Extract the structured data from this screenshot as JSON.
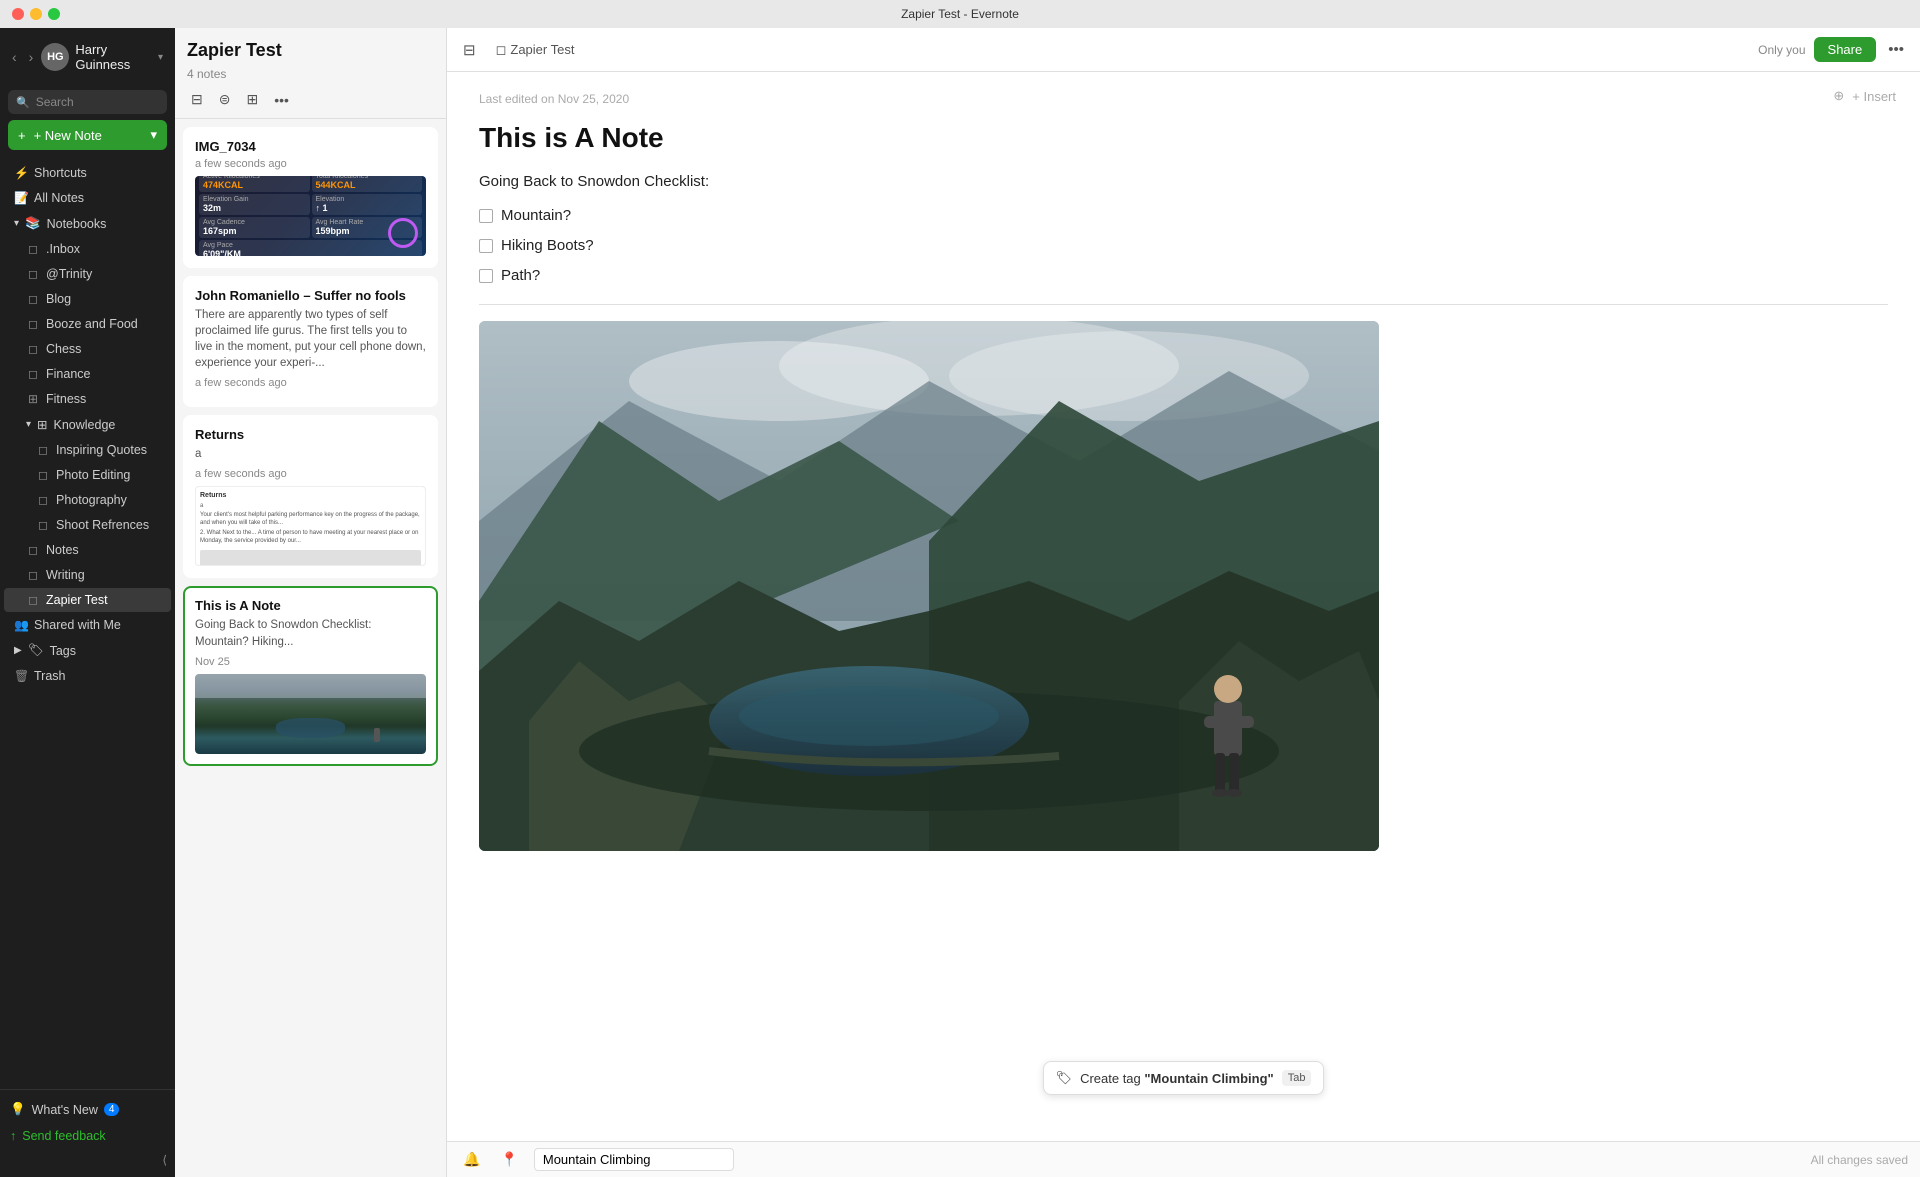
{
  "app": {
    "title": "Zapier Test - Evernote"
  },
  "titlebar": {
    "title": "Zapier Test - Evernote"
  },
  "sidebar": {
    "user": {
      "name": "Harry Guinness",
      "initials": "HG"
    },
    "search_placeholder": "Search",
    "new_note_label": "+ New Note",
    "nav_items": [
      {
        "id": "shortcuts",
        "label": "Shortcuts",
        "icon": "⚡"
      },
      {
        "id": "all-notes",
        "label": "All Notes",
        "icon": "📝"
      }
    ],
    "notebooks_header": "Notebooks",
    "notebooks": [
      {
        "id": "inbox",
        "label": ".Inbox",
        "indent": 1
      },
      {
        "id": "trinity",
        "label": "@Trinity",
        "indent": 1
      },
      {
        "id": "blog",
        "label": "Blog",
        "indent": 1
      },
      {
        "id": "booze-food",
        "label": "Booze and Food",
        "indent": 1
      },
      {
        "id": "chess",
        "label": "Chess",
        "indent": 1
      },
      {
        "id": "finance",
        "label": "Finance",
        "indent": 1
      },
      {
        "id": "fitness",
        "label": "Fitness",
        "indent": 1
      },
      {
        "id": "knowledge",
        "label": "Knowledge",
        "indent": 1,
        "expanded": true
      },
      {
        "id": "inspiring-quotes",
        "label": "Inspiring Quotes",
        "indent": 2
      },
      {
        "id": "photo-editing",
        "label": "Photo Editing",
        "indent": 2
      },
      {
        "id": "photography",
        "label": "Photography",
        "indent": 2
      },
      {
        "id": "shoot-refs",
        "label": "Shoot Refrences",
        "indent": 2
      },
      {
        "id": "notes",
        "label": "Notes",
        "indent": 1
      },
      {
        "id": "writing",
        "label": "Writing",
        "indent": 1
      },
      {
        "id": "zapier-test",
        "label": "Zapier Test",
        "indent": 1,
        "active": true
      }
    ],
    "shared_with_me": "Shared with Me",
    "tags": "Tags",
    "trash": "Trash",
    "whats_new": "What's New",
    "whats_new_badge": "4",
    "feedback": "Send feedback"
  },
  "notes_panel": {
    "title": "Zapier Test",
    "count": "4 notes",
    "notes": [
      {
        "id": "img7034",
        "title": "IMG_7034",
        "time": "a few seconds ago",
        "preview": "",
        "has_fitness_thumb": true
      },
      {
        "id": "john-romaniello",
        "title": "John Romaniello – Suffer no fools",
        "time": "",
        "preview": "There are apparently two types of self proclaimed life gurus. The first tells you to live in the moment, put your cell phone down, experience your experi-...",
        "timestamp": "a few seconds ago"
      },
      {
        "id": "returns",
        "title": "Returns",
        "time": "a few seconds ago",
        "preview": "a",
        "has_doc_thumb": true
      },
      {
        "id": "this-is-a-note",
        "title": "This is A Note",
        "time": "",
        "preview": "Going Back to Snowdon Checklist: Mountain? Hiking...",
        "timestamp": "Nov 25",
        "selected": true,
        "has_mountain_thumb": true
      }
    ]
  },
  "editor": {
    "notebook_name": "Zapier Test",
    "only_you": "Only you",
    "share_label": "Share",
    "insert_label": "+ Insert",
    "last_edited": "Last edited on Nov 25, 2020",
    "note_title": "This is A Note",
    "checklist_header": "Going Back to Snowdon Checklist:",
    "checklist_items": [
      "Mountain?",
      "Hiking Boots?",
      "Path?"
    ],
    "tag_suggestion": "Create tag \"Mountain Climbing\"",
    "tab_label": "Tab",
    "tag_input_value": "Mountain Climbing",
    "status": "All changes saved"
  }
}
